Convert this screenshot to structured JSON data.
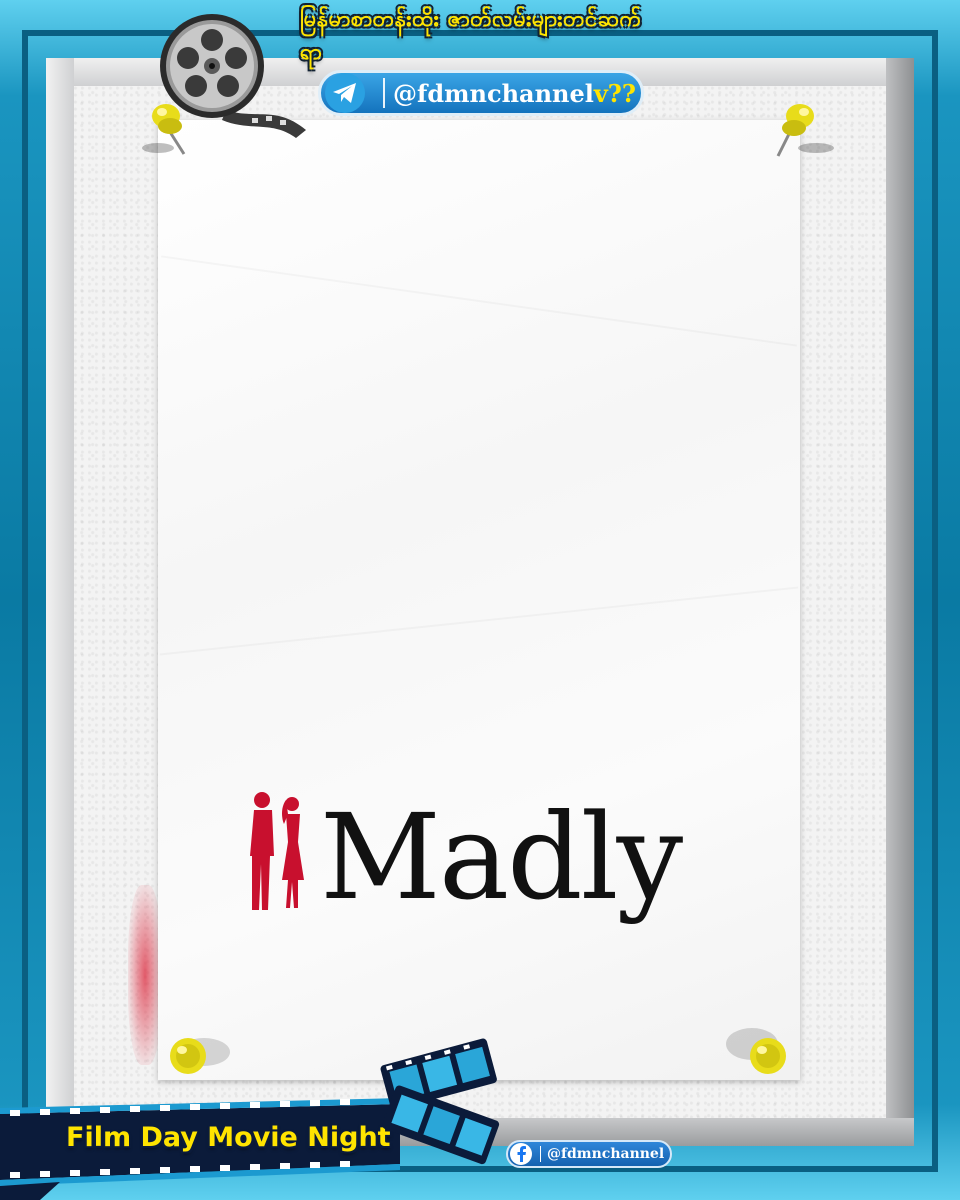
{
  "header": {
    "title": "မြန်မာစာတန်းထိုး ဇာတ်လမ်းများတင်ဆက်ရာ",
    "telegram_handle_main": "@fdmnchannel",
    "telegram_handle_suffix": "v??"
  },
  "poster": {
    "title": "Madly"
  },
  "footer": {
    "banner_text": "Film Day Movie Night",
    "facebook_handle": "@fdmnchannel"
  },
  "colors": {
    "frame_blue": "#0f7fa6",
    "title_yellow": "#ffe400",
    "logo_red": "#c8102e",
    "telegram_blue": "#2aa1e2",
    "facebook_blue": "#1877f2"
  },
  "icons": [
    "film-reel-icon",
    "telegram-icon",
    "pushpin-icon",
    "film-strip-icon",
    "facebook-icon",
    "couple-silhouette-icon"
  ]
}
